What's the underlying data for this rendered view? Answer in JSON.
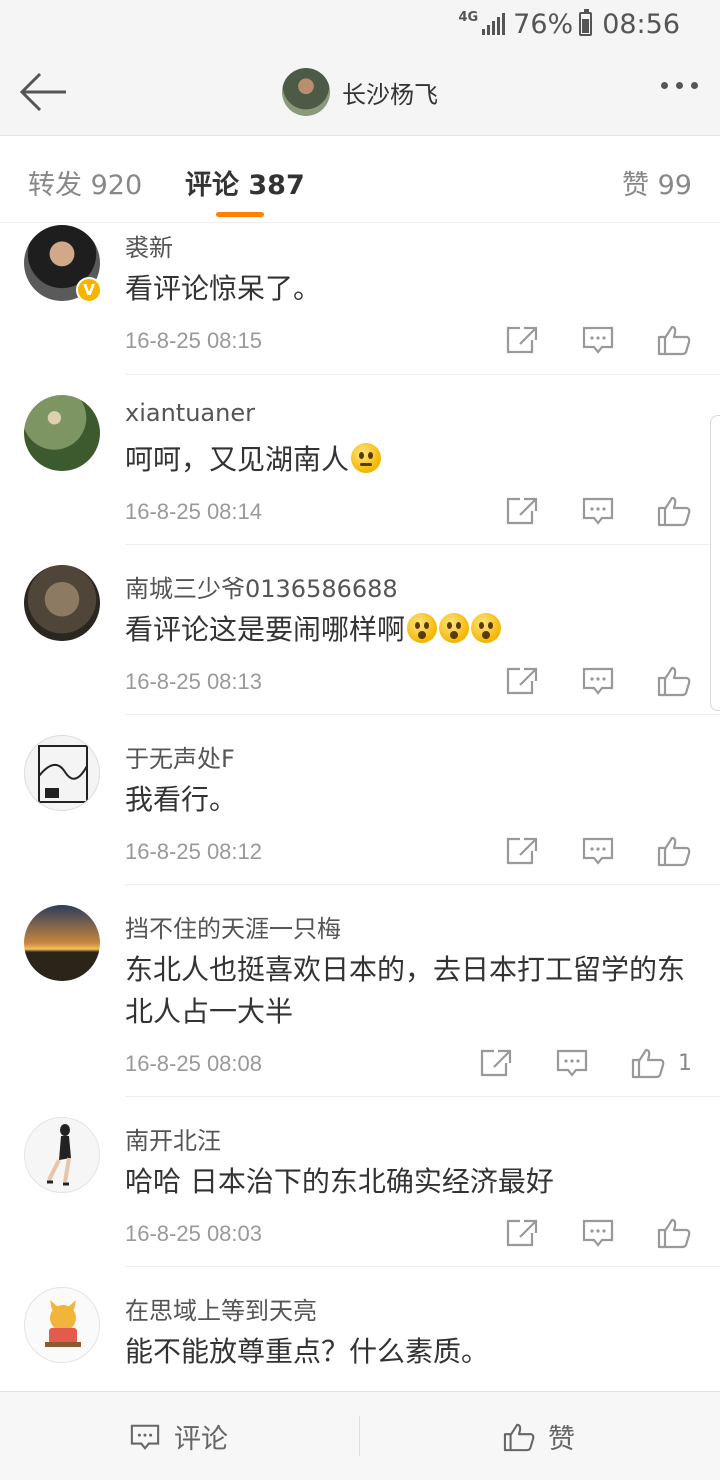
{
  "status_bar": {
    "network": "4G",
    "battery": "76%",
    "time": "08:56"
  },
  "nav": {
    "title": "长沙杨飞"
  },
  "tabs": {
    "repost": "转发 920",
    "comment": "评论 387",
    "like": "赞 99",
    "active": "comment"
  },
  "comments": [
    {
      "name": "裘新",
      "text": "看评论惊呆了。",
      "time": "16-8-25 08:15",
      "verified": true
    },
    {
      "name": "xiantuaner",
      "text": "呵呵，又见湖南人",
      "time": "16-8-25 08:14",
      "emoji": "think-emoji"
    },
    {
      "name": "南城三少爷0136586688",
      "text": "看评论这是要闹哪样啊",
      "time": "16-8-25 08:13",
      "emoji": "shock-emoji x3"
    },
    {
      "name": "于无声处F",
      "text": "我看行。",
      "time": "16-8-25 08:12"
    },
    {
      "name": "挡不住的天涯一只梅",
      "text": "东北人也挺喜欢日本的，去日本打工留学的东北人占一大半",
      "time": "16-8-25 08:08",
      "likes": "1"
    },
    {
      "name": "南开北汪",
      "text": "哈哈 日本治下的东北确实经济最好",
      "time": "16-8-25 08:03"
    },
    {
      "name": "在思域上等到天亮",
      "text": "能不能放尊重点？什么素质。",
      "time": ""
    }
  ],
  "bottom_bar": {
    "comment_label": "评论",
    "like_label": "赞"
  },
  "colors": {
    "accent": "#ff8200",
    "badge": "#f7b500"
  }
}
